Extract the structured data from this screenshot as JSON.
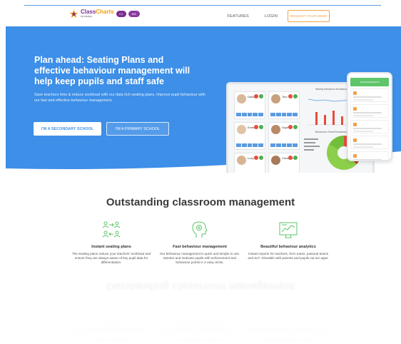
{
  "header": {
    "logo_name_1": "Class",
    "logo_name_2": "Charts",
    "logo_tagline": "by edukey",
    "pill_1": "CC",
    "pill_2": "MIS",
    "nav": [
      "FEATURES",
      "LOGIN"
    ],
    "demo_button": "REQUEST YOUR DEMO"
  },
  "hero": {
    "title": "Plan ahead: Seating Plans and effective behaviour management will help keep pupils and staff safe",
    "subtitle": "Save teachers time & reduce workload with our data rich seating plans. Improve pupil behaviour with our fast and effective behaviour management.",
    "secondary_button": "I'M A SECONDARY SCHOOL",
    "primary_button": "I'M A PRIMARY SCHOOL",
    "seat_names": [
      "Danielle",
      "Tom",
      "Emma",
      "Sophia",
      "Lucy",
      "Christian"
    ],
    "phone_header": "ANNOUNCEMENTS",
    "chart_title_1": "Weekly Behaviour Breakdown",
    "chart_title_2": "Behaviour Points Breakdown",
    "accent_color": "#3d8fe8"
  },
  "features_section": {
    "title": "Outstanding classroom management",
    "items": [
      {
        "icon": "seating-plan-icon",
        "title": "Instant seating plans",
        "text": "The seating plans reduce your teachers' workload and ensure they are always aware of key pupil data for differentiation."
      },
      {
        "icon": "head-behaviour-icon",
        "title": "Fast behaviour management",
        "text": "Our behaviour management is quick and simple to use. Monitor and motivate pupils with achievement and behaviour points in 2 easy clicks."
      },
      {
        "icon": "analytics-screen-icon",
        "title": "Beautiful behaviour analytics",
        "text": "Instant reports for teachers, form tutors, pastoral teams and SLT. Sharable with parents and pupils via our apps."
      }
    ]
  }
}
